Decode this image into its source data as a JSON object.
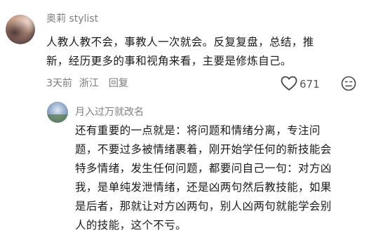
{
  "comment": {
    "author": "奥莉 stylist",
    "text": "人教人教不会，事教人一次就会。反复复盘，总结，推\n新，经历更多的事和视角来看，主要是修炼自己。",
    "time": "3天前",
    "location": "浙江",
    "reply_label": "回复",
    "like_count": "671",
    "icons": [
      "heart-outline-icon",
      "dislike-face-icon"
    ]
  },
  "reply": {
    "author": "月入过万就改名",
    "text": "还有重要的一点就是：将问题和情绪分离，专注问\n题，不要过多被情绪裹着，刚开始学任何的新技能会\n特多情绪，发生任何问题，都要问自己一句：对方凶\n我，是单纯发泄情绪，还是凶两句然后教技能，如果\n是后者，那就让对方凶两句，别人凶两句就能学会别\n人的技能，这个不亏。"
  },
  "colors": {
    "text": "#1a1a1a",
    "meta": "#7a7a7a",
    "name": "#7f7f7f"
  }
}
